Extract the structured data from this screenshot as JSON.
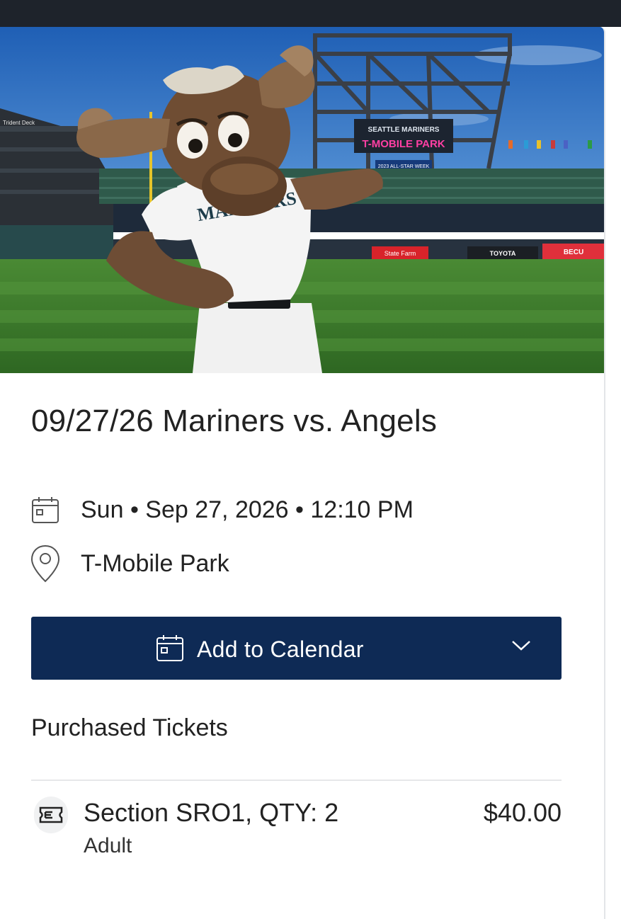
{
  "event": {
    "title": "09/27/26 Mariners vs. Angels",
    "datetime": "Sun • Sep 27, 2026 • 12:10 PM",
    "venue": "T-Mobile Park"
  },
  "hero": {
    "ballpark_sign": "T-MOBILE PARK",
    "board_top": "SEATTLE MARINERS",
    "board_sub": "2023 ALL-STAR WEEK",
    "jersey_text": "MARINERS",
    "ads": [
      "State Farm",
      "TOYOTA",
      "BECU"
    ],
    "deck_label": "Trident Deck"
  },
  "actions": {
    "add_to_calendar": "Add to Calendar"
  },
  "tickets": {
    "heading": "Purchased Tickets",
    "items": [
      {
        "section": "Section SRO1, QTY: 2",
        "type": "Adult",
        "price": "$40.00"
      }
    ]
  },
  "colors": {
    "primary": "#0e2a55",
    "topbar": "#1e232b",
    "sky": "#2a6fc2",
    "grass": "#3c7a2c"
  },
  "icons": {
    "date": "calendar-icon",
    "venue": "map-pin-icon",
    "button": "calendar-icon",
    "dropdown": "chevron-down-icon",
    "ticket": "ticket-icon"
  }
}
